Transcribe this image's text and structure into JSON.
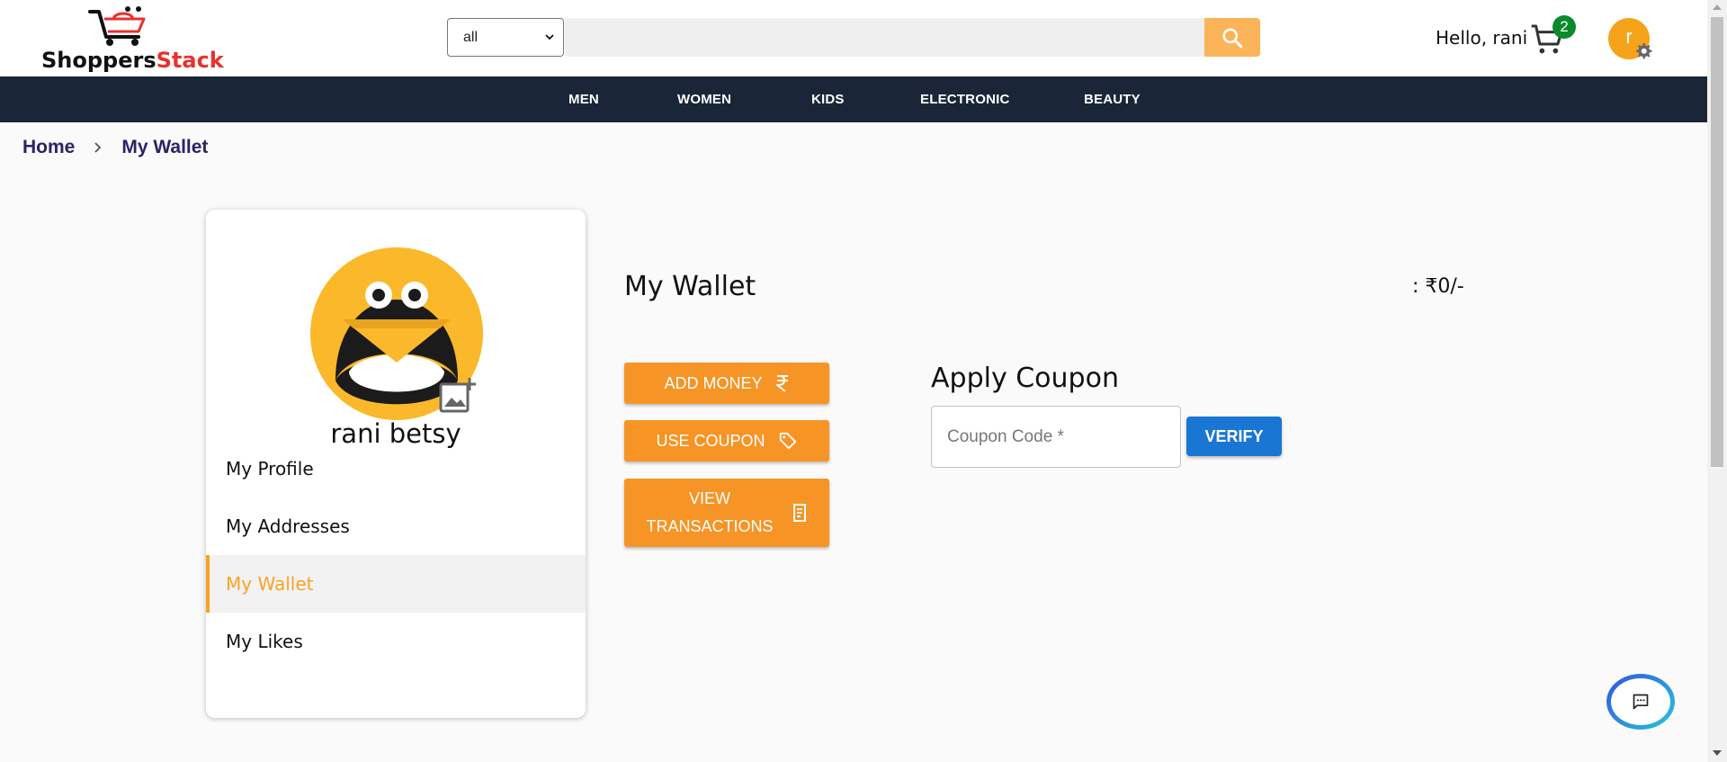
{
  "header": {
    "logo": {
      "part1": "Shoppers",
      "part2": "Stack"
    },
    "search": {
      "category": "all",
      "placeholder": ""
    },
    "greeting": "Hello, rani",
    "cart_count": "2",
    "avatar_initial": "r"
  },
  "nav": {
    "items": [
      "MEN",
      "WOMEN",
      "KIDS",
      "ELECTRONIC",
      "BEAUTY"
    ]
  },
  "breadcrumb": {
    "home": "Home",
    "current": "My Wallet"
  },
  "sidebar": {
    "user_name": "rani betsy",
    "menu": [
      {
        "label": "My Profile",
        "active": false
      },
      {
        "label": "My Addresses",
        "active": false
      },
      {
        "label": "My Wallet",
        "active": true
      },
      {
        "label": "My Likes",
        "active": false
      }
    ]
  },
  "wallet": {
    "title": "My Wallet",
    "balance": ": ₹0/-",
    "buttons": {
      "add_money": "ADD MONEY",
      "use_coupon": "USE COUPON",
      "view_transactions_line1": "VIEW",
      "view_transactions_line2": "TRANSACTIONS"
    }
  },
  "coupon": {
    "title": "Apply Coupon",
    "placeholder": "Coupon Code *",
    "verify_label": "VERIFY"
  },
  "colors": {
    "nav_bg": "#1a2538",
    "accent_orange": "#f69426",
    "verify_blue": "#1976d2",
    "cart_badge": "#0b8a2c",
    "avatar": "#f5a31a"
  },
  "icons": {
    "logo": "shopping-cart-logo-icon",
    "search": "search-icon",
    "cart": "cart-icon",
    "settings": "gear-icon",
    "upload_image": "add-photo-icon",
    "rupee": "rupee-icon",
    "tag": "tag-icon",
    "receipt": "receipt-icon",
    "chat": "chat-icon"
  }
}
